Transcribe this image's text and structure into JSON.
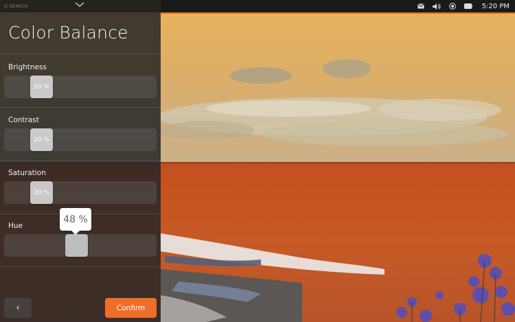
{
  "status_bar": {
    "time": "5:20 PM",
    "icons": [
      "mail-icon",
      "volume-icon",
      "wifi-icon",
      "battery-icon"
    ]
  },
  "panel": {
    "top_hint": "Q SEARCH",
    "title": "Color Balance",
    "sliders": [
      {
        "label": "Brightness",
        "value_text": "20 %",
        "value": 20
      },
      {
        "label": "Contrast",
        "value_text": "20 %",
        "value": 20
      },
      {
        "label": "Saturation",
        "value_text": "20 %",
        "value": 20
      },
      {
        "label": "Hue",
        "value_text": "48 %",
        "value": 48
      }
    ],
    "back_label": "‹",
    "confirm_label": "Confirm"
  },
  "colors": {
    "accent": "#ef6e2a",
    "panel_bg": "#262626",
    "sky": "#e6b45e",
    "sea": "#c45423"
  }
}
